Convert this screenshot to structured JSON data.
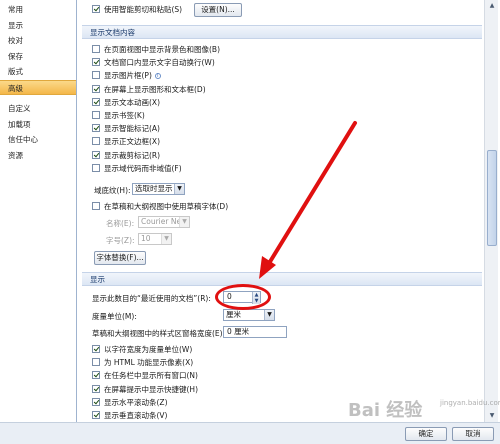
{
  "nav": {
    "items": [
      "常用",
      "显示",
      "校对",
      "保存",
      "版式",
      "高级",
      "自定义",
      "加载项",
      "信任中心",
      "资源"
    ],
    "active_index": 5
  },
  "top": {
    "smart_cut_paste": "使用智能剪切和粘贴(S)",
    "settings_button": "设置(N)..."
  },
  "doc_content": {
    "header": "显示文档内容",
    "items": [
      {
        "label": "在页面视图中显示背景色和图像(B)",
        "checked": false
      },
      {
        "label": "文档窗口内显示文字自动换行(W)",
        "checked": true
      },
      {
        "label": "显示图片框(P)",
        "checked": false,
        "info": true
      },
      {
        "label": "在屏幕上显示图形和文本框(D)",
        "checked": true
      },
      {
        "label": "显示文本动画(X)",
        "checked": true
      },
      {
        "label": "显示书签(K)",
        "checked": false
      },
      {
        "label": "显示智能标记(A)",
        "checked": true
      },
      {
        "label": "显示正文边框(X)",
        "checked": false
      },
      {
        "label": "显示裁剪标记(R)",
        "checked": true
      },
      {
        "label": "显示域代码而非域值(F)",
        "checked": false
      }
    ],
    "field_shading_label": "域底纹(H):",
    "field_shading_value": "选取时显示",
    "draft_font_label": "在草稿和大纲视图中使用草稿字体(D)",
    "name_label": "名称(E):",
    "name_value": "Courier New",
    "size_label": "字号(Z):",
    "size_value": "10",
    "font_substitution_button": "字体替换(F)..."
  },
  "display": {
    "header": "显示",
    "recent_docs_label": "显示此数目的“最近使用的文档”(R):",
    "recent_docs_value": "0",
    "units_label": "度量单位(M):",
    "units_value": "厘米",
    "style_area_label": "草稿和大纲视图中的样式区窗格宽度(E):",
    "style_area_value": "0 厘米",
    "items": [
      {
        "label": "以字符宽度为度量单位(W)",
        "checked": true
      },
      {
        "label": "为 HTML 功能显示像素(X)",
        "checked": false
      },
      {
        "label": "在任务栏中显示所有窗口(N)",
        "checked": true
      },
      {
        "label": "在屏幕提示中显示快捷键(H)",
        "checked": true
      },
      {
        "label": "显示水平滚动条(Z)",
        "checked": true
      },
      {
        "label": "显示垂直滚动条(V)",
        "checked": true
      }
    ]
  },
  "footer": {
    "ok": "确定",
    "cancel": "取消"
  },
  "watermark": {
    "text": "Bai 经验",
    "sub": "jingyan.baidu.com"
  },
  "colors": {
    "active_nav": "#f4b74a",
    "annotation": "#e01010",
    "section_header": "#dce6f4"
  }
}
